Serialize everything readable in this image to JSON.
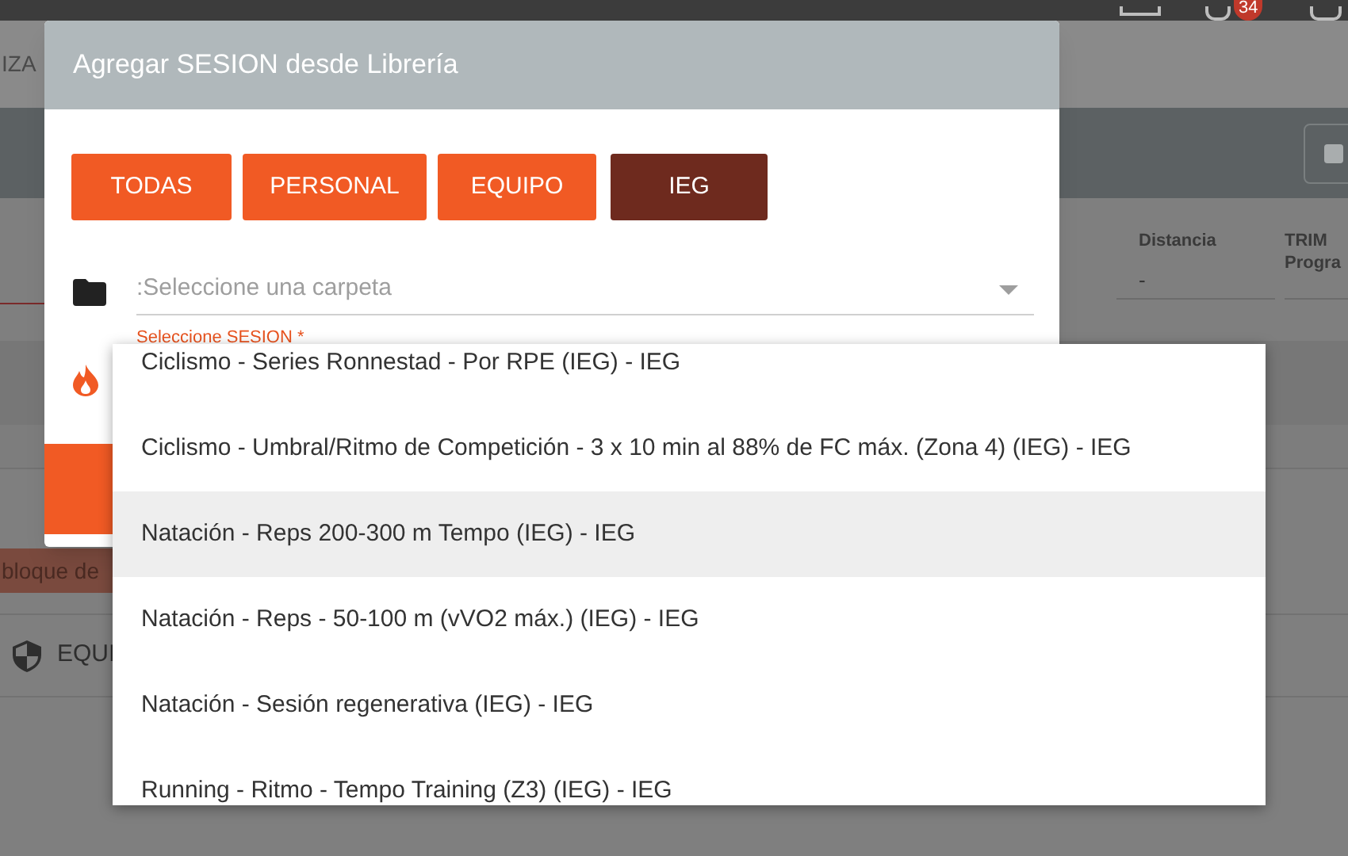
{
  "background": {
    "notification_count": "34",
    "header_text": "IZA",
    "columns": [
      {
        "label_lines": [
          "Distancia"
        ],
        "value": "-"
      },
      {
        "label_lines": [
          "TRIM",
          "Progra"
        ]
      }
    ],
    "chip": "bloque de",
    "section": "EQUI"
  },
  "modal": {
    "title": "Agregar SESION desde Librería",
    "tabs": [
      {
        "label": "TODAS",
        "selected": false
      },
      {
        "label": "PERSONAL",
        "selected": false
      },
      {
        "label": "EQUIPO",
        "selected": false
      },
      {
        "label": "IEG",
        "selected": true
      }
    ],
    "folder_select": {
      "placeholder": ":Seleccione una carpeta"
    },
    "session_label": "Seleccione SESION *",
    "options": [
      {
        "label": "Ciclismo - Series Ronnestad - Por RPE (IEG) - IEG",
        "selected": false
      },
      {
        "label": "Ciclismo - Umbral/Ritmo de Competición - 3 x 10 min al 88% de FC máx. (Zona 4) (IEG) - IEG",
        "selected": false
      },
      {
        "label": "Natación - Reps 200-300 m Tempo (IEG) - IEG",
        "selected": true
      },
      {
        "label": "Natación - Reps - 50-100 m (vVO2 máx.) (IEG) - IEG",
        "selected": false
      },
      {
        "label": "Natación - Sesión regenerativa (IEG) - IEG",
        "selected": false
      },
      {
        "label": "Running - Ritmo - Tempo Training (Z3) (IEG) - IEG",
        "selected": false
      }
    ]
  }
}
